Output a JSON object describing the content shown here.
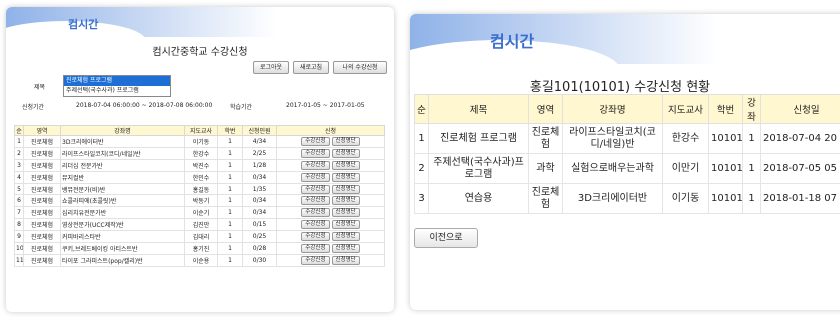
{
  "logo_text": "컴시간",
  "left": {
    "title": "컴시간중학교 수강신청",
    "buttons": {
      "logout": "로그아웃",
      "refresh": "새로고침",
      "my": "나의 수강신청"
    },
    "subject_label": "제목",
    "options": [
      "진로체험 프로그램",
      "주제선택(국수사과) 프로그램"
    ],
    "period_label": "신청기간",
    "period_value": "2018-07-04 06:00:00 ~ 2018-07-08 06:00:00",
    "study_label": "학습기간",
    "study_value": "2017-01-05 ~ 2017-01-05",
    "headers": [
      "순",
      "영역",
      "강좌명",
      "지도교사",
      "학번",
      "신청인원",
      "신청"
    ],
    "btn_apply": "수강신청",
    "btn_list": "신청명단",
    "rows": [
      [
        "1",
        "진로체험",
        "3D크리에이터반",
        "이기동",
        "1",
        "4/34"
      ],
      [
        "2",
        "진로체험",
        "라이프스타일코치(코디/네일)반",
        "한강수",
        "1",
        "2/25"
      ],
      [
        "3",
        "진로체험",
        "리더십 전문가반",
        "박진수",
        "1",
        "1/28"
      ],
      [
        "4",
        "진로체험",
        "뮤지컬반",
        "한민수",
        "1",
        "0/34"
      ],
      [
        "5",
        "진로체험",
        "뱅뮤전문가(비)반",
        "홍길동",
        "1",
        "1/35"
      ],
      [
        "6",
        "진로체험",
        "쇼콜라띠에(초콜릿)반",
        "박동기",
        "1",
        "0/34"
      ],
      [
        "7",
        "진로체험",
        "심리치유전문가반",
        "이순기",
        "1",
        "0/34"
      ],
      [
        "8",
        "진로체험",
        "영상전문가(UCC제작)반",
        "김진만",
        "1",
        "0/15"
      ],
      [
        "9",
        "진로체험",
        "커피바리스타반",
        "김대리",
        "1",
        "0/25"
      ],
      [
        "10",
        "진로체험",
        "쿠키,브레드베이킹 아티스트반",
        "홍기진",
        "1",
        "0/28"
      ],
      [
        "11",
        "진로체험",
        "타이포 그라피스트(pop/캘리)반",
        "이순용",
        "1",
        "0/30"
      ]
    ]
  },
  "right": {
    "title": "홍길101(10101) 수강신청 현황",
    "headers": [
      "순",
      "제목",
      "영역",
      "강좌명",
      "지도교사",
      "학번",
      "강좌",
      "신청일"
    ],
    "rows": [
      [
        "1",
        "진로체험 프로그램",
        "진로체험",
        "라이프스타일코치(코디/네일)반",
        "한강수",
        "10101",
        "1",
        "2018-07-04 20"
      ],
      [
        "2",
        "주제선택(국수사과)프로그램",
        "과학",
        "실험으로배우는과학",
        "이만기",
        "10101",
        "1",
        "2018-07-05 05"
      ],
      [
        "3",
        "연습용",
        "진로체험",
        "3D크리에이터반",
        "이기동",
        "10101",
        "1",
        "2018-01-18 07"
      ]
    ],
    "back_label": "이전으로"
  }
}
